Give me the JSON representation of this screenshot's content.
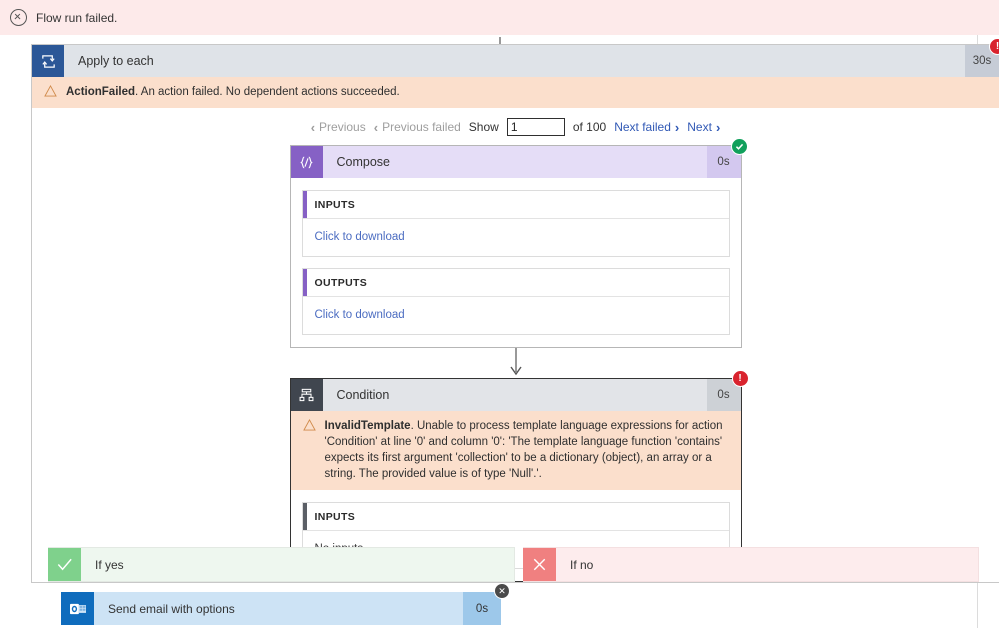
{
  "banner": {
    "icon": "error-circle-x-icon",
    "text": "Flow run failed."
  },
  "loop": {
    "icon": "loop-repeat-icon",
    "title": "Apply to each",
    "duration": "30s",
    "status_badge": "!",
    "error": {
      "code": "ActionFailed",
      "message": ". An action failed. No dependent actions succeeded."
    }
  },
  "pager": {
    "previous": "Previous",
    "previous_failed": "Previous failed",
    "show_label": "Show",
    "page_value": "1",
    "page_placeholder": "",
    "of_total": "of 100",
    "next_failed": "Next failed",
    "next": "Next",
    "chevron_left": "‹",
    "chevron_right": "›"
  },
  "compose": {
    "icon": "compose-braces-icon",
    "title": "Compose",
    "duration": "0s",
    "status_badge": "success-check-icon",
    "inputs": {
      "label": "INPUTS",
      "value": "Click to download",
      "is_link": true
    },
    "outputs": {
      "label": "OUTPUTS",
      "value": "Click to download",
      "is_link": true
    },
    "accent": "#8661c5"
  },
  "condition": {
    "icon": "condition-branch-icon",
    "title": "Condition",
    "duration": "0s",
    "status_badge": "!",
    "error": {
      "code": "InvalidTemplate",
      "message": ". Unable to process template language expressions for action 'Condition' at line '0' and column '0': 'The template language function 'contains' expects its first argument 'collection' to be a dictionary (object), an array or a string. The provided value is of type 'Null'.'."
    },
    "inputs": {
      "label": "INPUTS",
      "value": "No inputs",
      "is_link": false
    },
    "accent": "#5b5f66"
  },
  "branches": {
    "yes": {
      "icon": "check-mark-icon",
      "label": "If yes"
    },
    "no": {
      "icon": "cross-mark-icon",
      "label": "If no"
    }
  },
  "email_action": {
    "icon": "outlook-icon",
    "title": "Send email with options",
    "duration": "0s",
    "close_label": "✕"
  },
  "colors": {
    "banner_bg": "#fdeaea",
    "error_strip_bg": "#fbdfcc",
    "loop_header_bg": "#dfe3e8",
    "loop_icon_bg": "#2b5797",
    "compose_header_bg": "#e5ddf7",
    "compose_icon_bg": "#8661c5",
    "condition_header_bg": "#e2e4e8",
    "condition_icon_bg": "#40464f",
    "yes_bg": "#eef7ef",
    "yes_icon_bg": "#7fd18c",
    "no_bg": "#fdeced",
    "no_icon_bg": "#f08080",
    "email_bg": "#cde3f5",
    "email_icon_bg": "#0f6cbd",
    "badge_error": "#d9232e",
    "badge_success": "#11a05c",
    "link": "#3159b5"
  }
}
